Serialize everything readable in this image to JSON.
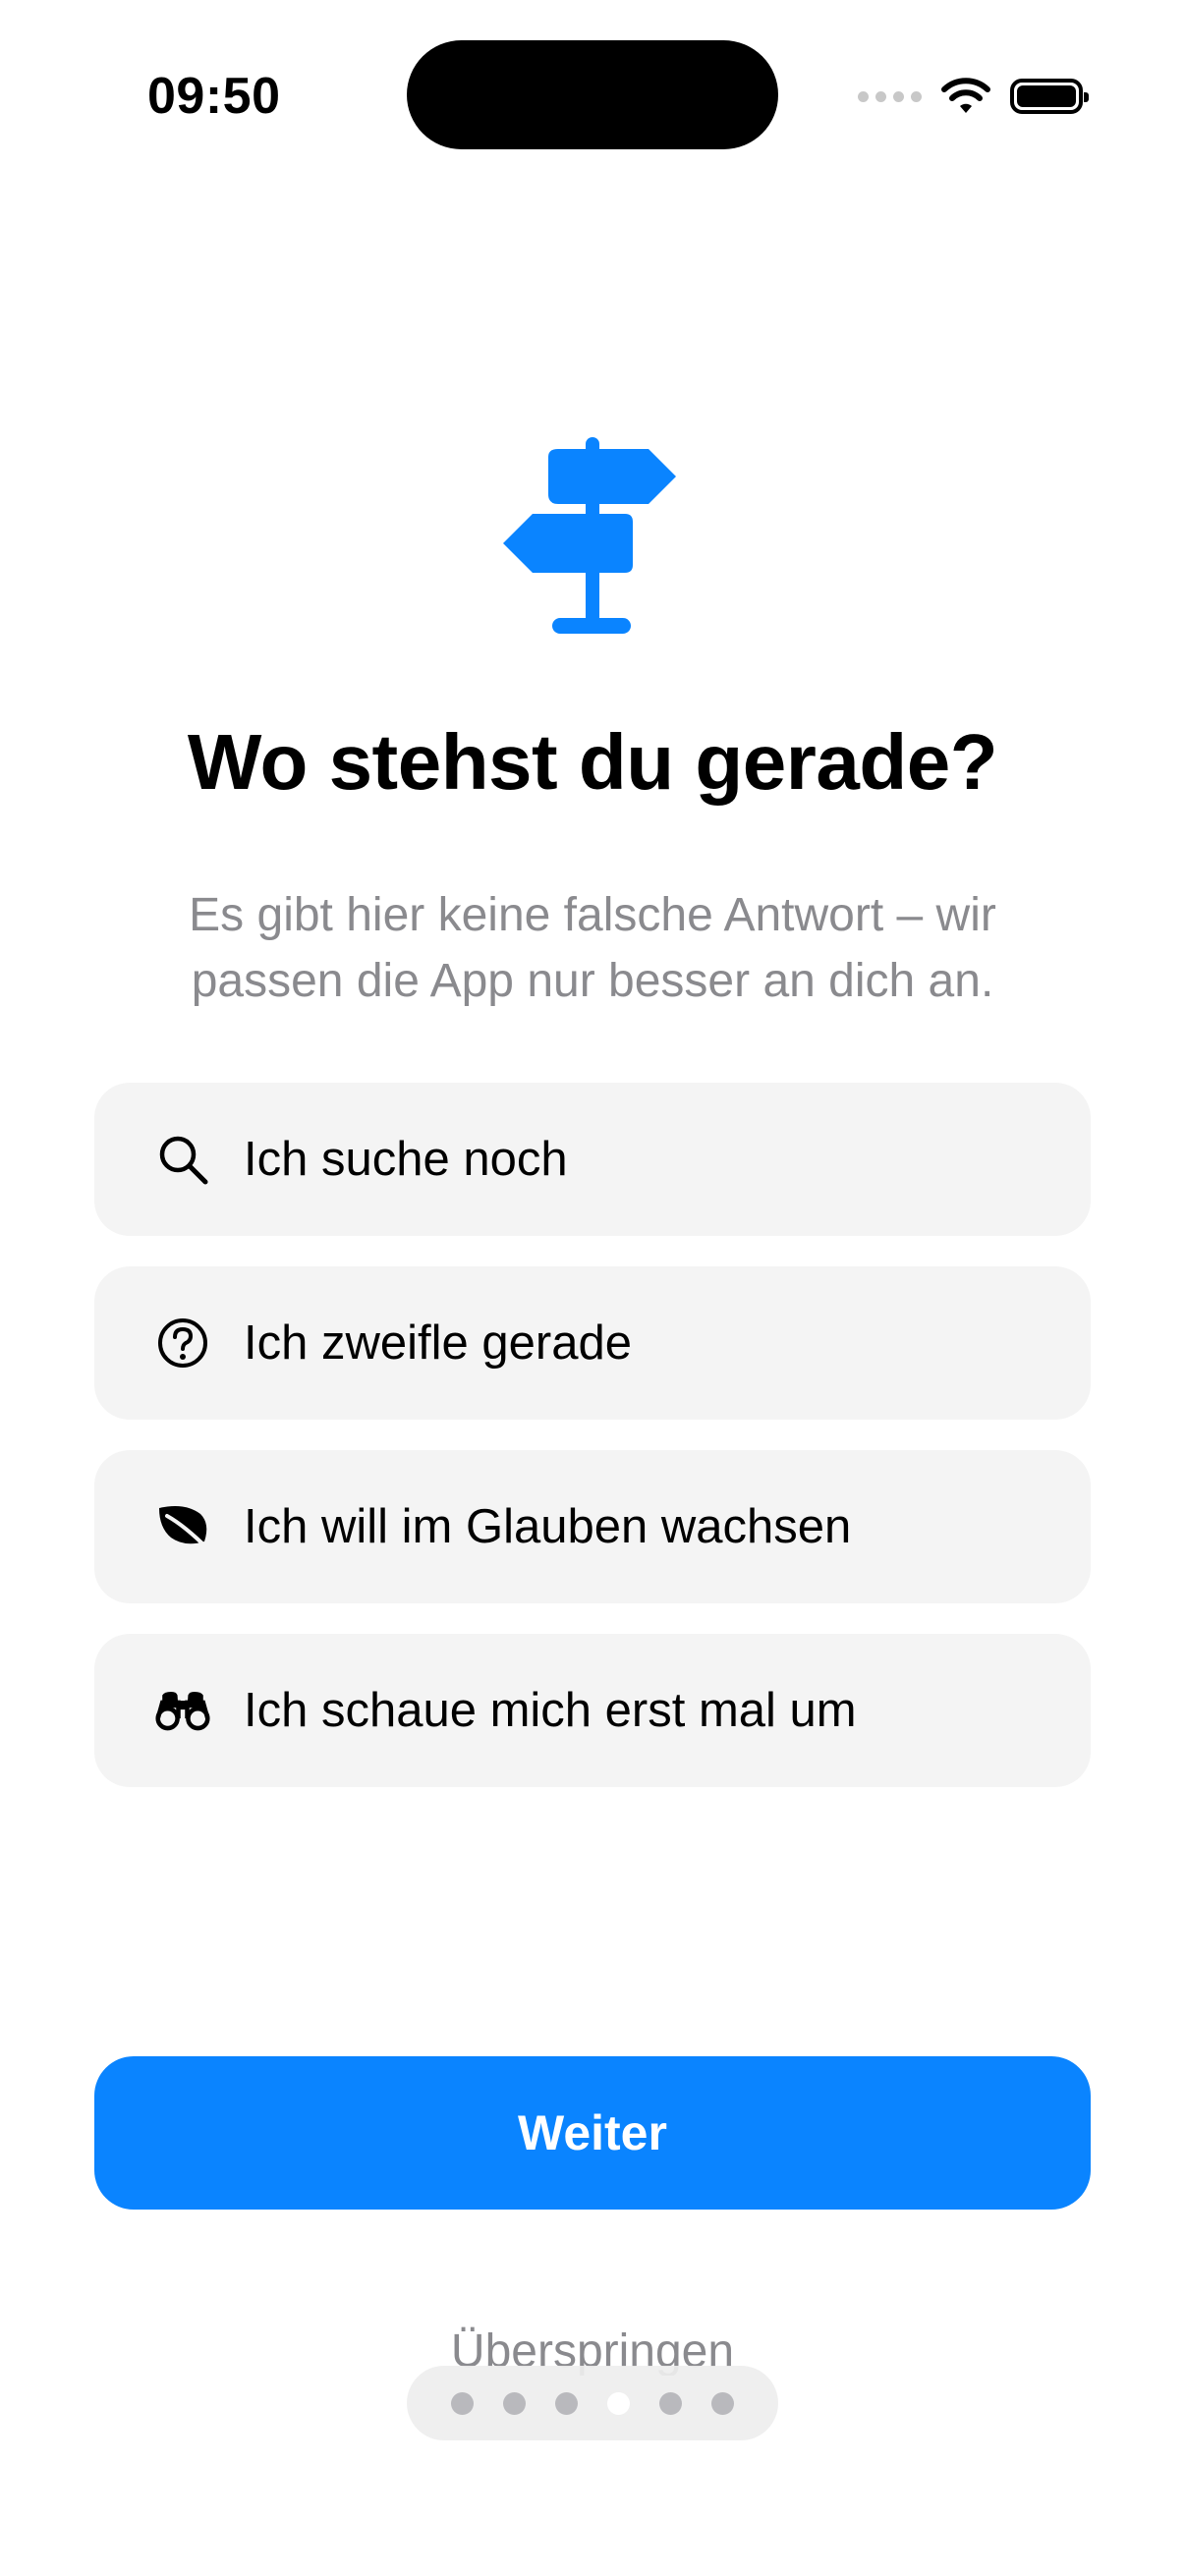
{
  "status_bar": {
    "time": "09:50"
  },
  "onboarding": {
    "hero_icon": "signpost-icon",
    "accent_color": "#0A84FF",
    "title": "Wo stehst du gerade?",
    "subtitle": "Es gibt hier keine falsche Antwort – wir passen die App nur besser an dich an.",
    "options": [
      {
        "icon": "magnifying-glass-icon",
        "label": "Ich suche noch"
      },
      {
        "icon": "question-circle-icon",
        "label": "Ich zweifle gerade"
      },
      {
        "icon": "leaf-icon",
        "label": "Ich will im Glauben wachsen"
      },
      {
        "icon": "binoculars-icon",
        "label": "Ich schaue mich erst mal um"
      }
    ],
    "primary_button": "Weiter",
    "skip_label": "Überspringen",
    "page_indicator": {
      "total": 6,
      "current": 4
    }
  }
}
